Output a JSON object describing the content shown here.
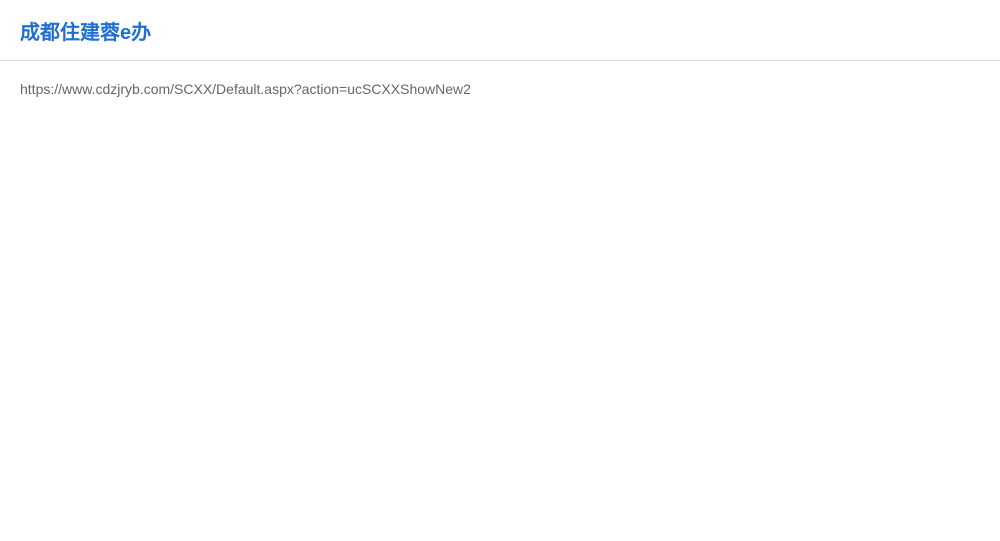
{
  "site": {
    "title": "成都住建蓉e办"
  },
  "page": {
    "url": "https://www.cdzjryb.com/SCXX/Default.aspx?action=ucSCXXShowNew2"
  }
}
